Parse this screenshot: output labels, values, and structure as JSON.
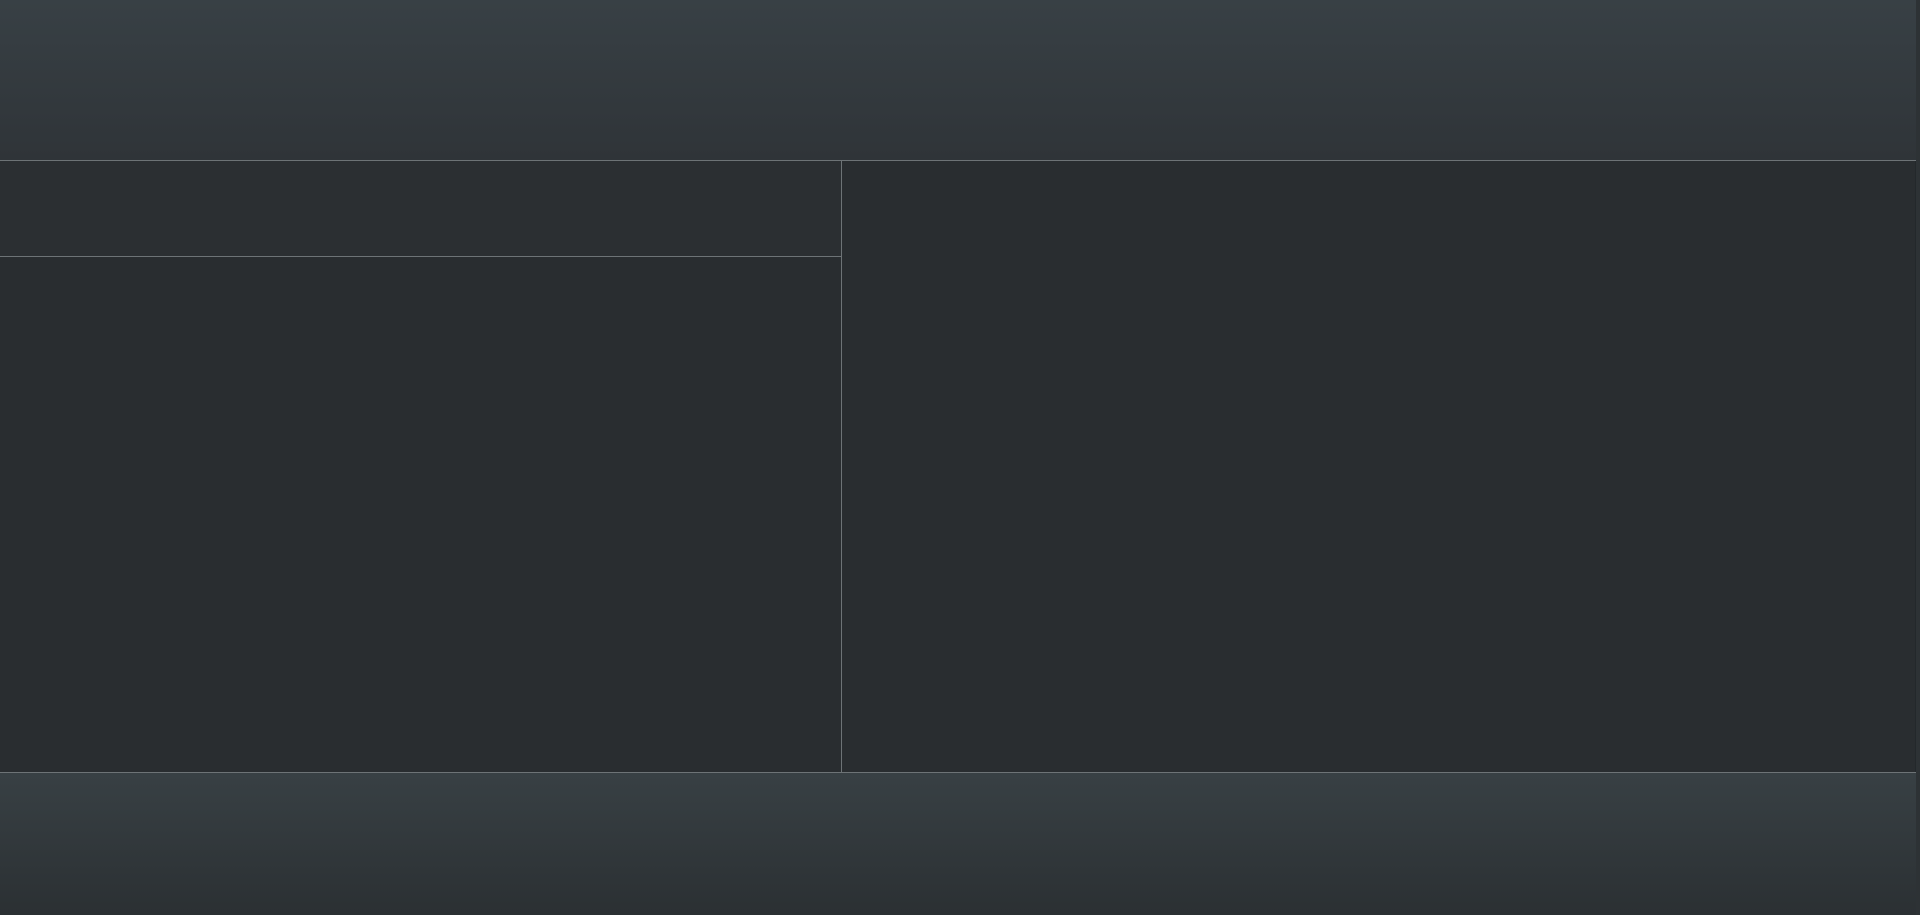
{
  "theme": {
    "background": "#23282b",
    "header_top": "#384045",
    "header_bottom": "#2f3438",
    "panel": "#292d30",
    "divider": "#6d7376",
    "footer_top": "#384044",
    "footer_bottom": "#2b3033"
  },
  "header": {},
  "left_panel": {
    "toolbar": {},
    "content": {}
  },
  "right_panel": {},
  "footer": {}
}
